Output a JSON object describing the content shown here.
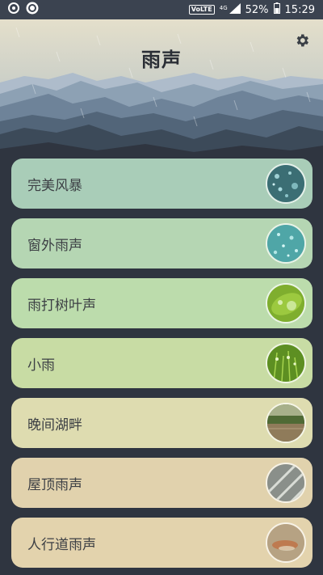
{
  "status_bar": {
    "volte": "VoLTE",
    "network": "4G",
    "battery": "52%",
    "time": "15:29"
  },
  "header": {
    "title": "雨声",
    "settings_icon": "gear-icon"
  },
  "sounds": [
    {
      "label": "完美风暴",
      "color": "#a9cdb8",
      "thumb": "dark-teal-water-drops"
    },
    {
      "label": "窗外雨声",
      "color": "#b5d6b3",
      "thumb": "teal-glass-droplets"
    },
    {
      "label": "雨打树叶声",
      "color": "#bcdcac",
      "thumb": "green-leaf-droplet"
    },
    {
      "label": "小雨",
      "color": "#c8dca4",
      "thumb": "green-grass-drops"
    },
    {
      "label": "晚间湖畔",
      "color": "#dedcb0",
      "thumb": "lakeside-reeds"
    },
    {
      "label": "屋顶雨声",
      "color": "#e1d2ad",
      "thumb": "roof-tiles"
    },
    {
      "label": "人行道雨声",
      "color": "#e3d3ad",
      "thumb": "wet-pavement"
    }
  ]
}
